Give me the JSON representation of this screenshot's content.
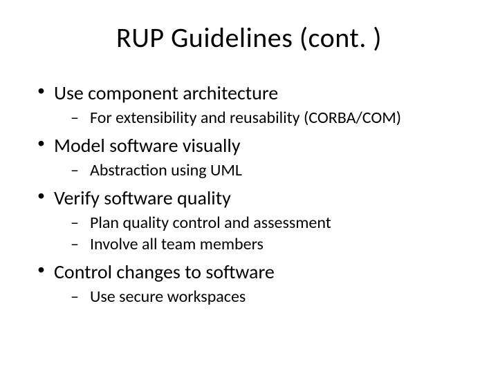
{
  "title": "RUP Guidelines (cont. )",
  "bullets": [
    {
      "text": "Use component architecture",
      "subs": [
        "For extensibility and reusability (CORBA/COM)"
      ]
    },
    {
      "text": "Model software visually",
      "subs": [
        "Abstraction using UML"
      ]
    },
    {
      "text": "Verify software quality",
      "subs": [
        "Plan quality control and assessment",
        "Involve all team members"
      ]
    },
    {
      "text": "Control changes to software",
      "subs": [
        "Use secure workspaces"
      ]
    }
  ]
}
